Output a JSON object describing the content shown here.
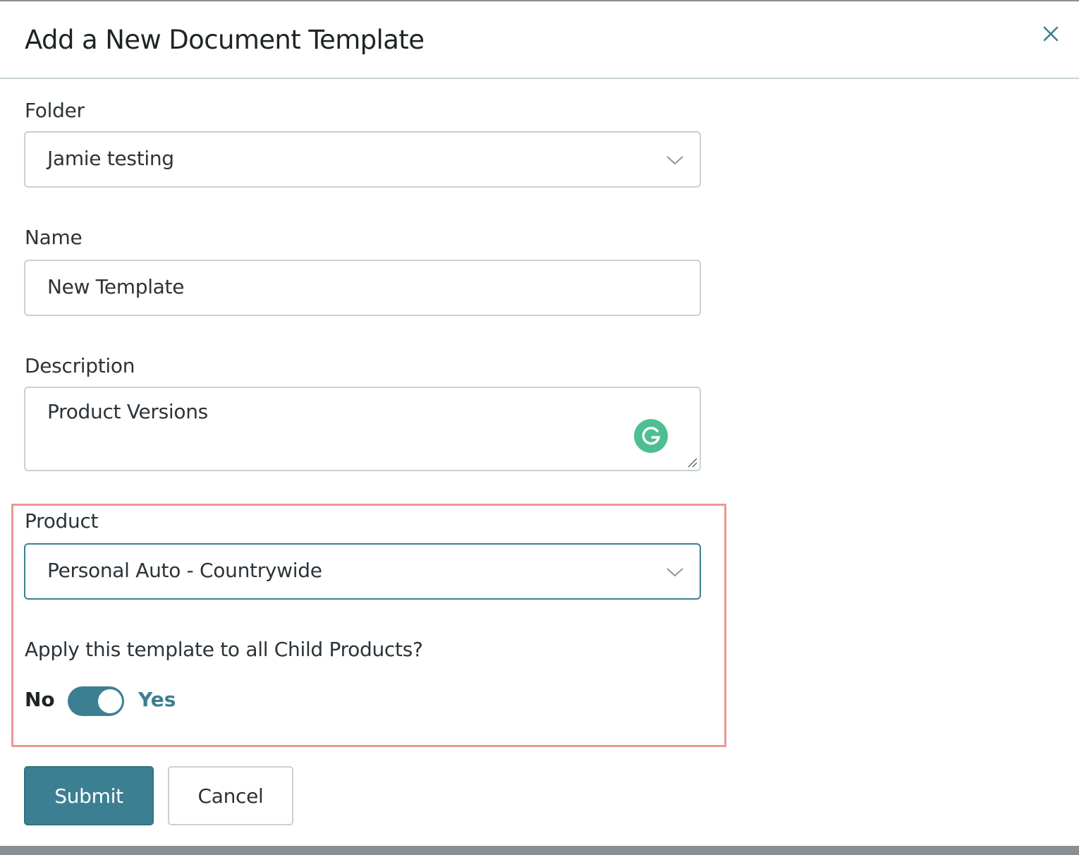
{
  "dialog": {
    "title": "Add a New Document Template"
  },
  "form": {
    "folder": {
      "label": "Folder",
      "value": "Jamie testing"
    },
    "name": {
      "label": "Name",
      "value": "New Template"
    },
    "description": {
      "label": "Description",
      "value": "Product Versions"
    },
    "product": {
      "label": "Product",
      "value": "Personal Auto - Countrywide"
    },
    "apply_child": {
      "question": "Apply this template to all Child Products?",
      "off_label": "No",
      "on_label": "Yes",
      "state": "on"
    }
  },
  "actions": {
    "submit_label": "Submit",
    "cancel_label": "Cancel"
  },
  "colors": {
    "accent": "#3d7f92",
    "highlight_border": "#eb9893",
    "grammarly": "#4fbf93"
  },
  "icons": [
    "close-icon",
    "chevron-down-icon",
    "grammarly-icon",
    "resize-handle-icon"
  ]
}
